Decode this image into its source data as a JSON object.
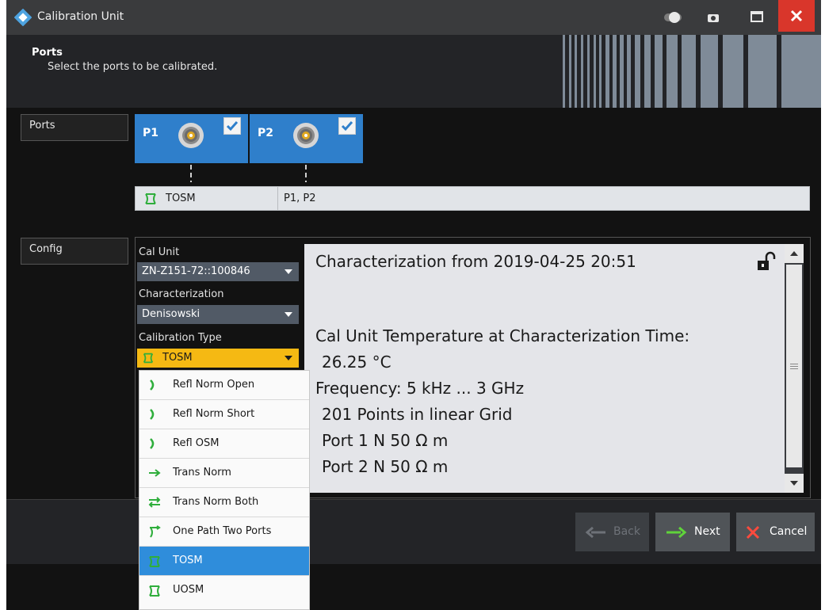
{
  "window": {
    "title": "Calibration Unit"
  },
  "header": {
    "title": "Ports",
    "subtitle": "Select the ports to be calibrated."
  },
  "sections": {
    "ports_label": "Ports",
    "config_label": "Config"
  },
  "ports": [
    {
      "name": "P1",
      "checked": true
    },
    {
      "name": "P2",
      "checked": true
    }
  ],
  "selection": {
    "type": "TOSM",
    "ports": "P1, P2"
  },
  "config": {
    "cal_unit_label": "Cal Unit",
    "cal_unit_value": "ZN-Z151-72::100846",
    "characterization_label": "Characterization",
    "characterization_value": "Denisowski",
    "calibration_type_label": "Calibration Type",
    "calibration_type_value": "TOSM"
  },
  "info": {
    "title": "Characterization from 2019-04-25 20:51",
    "lines": [
      "Cal Unit Temperature at Characterization Time:",
      "26.25 °C",
      "Frequency: 5 kHz ... 3 GHz",
      "201 Points in linear Grid",
      "Port 1 N 50 Ω m",
      "Port 2 N 50 Ω m"
    ]
  },
  "dropdown": {
    "items": [
      {
        "label": "Refl Norm Open",
        "icon": "refl-icon"
      },
      {
        "label": "Refl Norm Short",
        "icon": "refl-icon"
      },
      {
        "label": "Refl OSM",
        "icon": "refl-icon"
      },
      {
        "label": "Trans Norm",
        "icon": "arrow-right-icon"
      },
      {
        "label": "Trans Norm Both",
        "icon": "arrows-both-icon"
      },
      {
        "label": "One Path Two Ports",
        "icon": "one-path-icon"
      },
      {
        "label": "TOSM",
        "icon": "two-port-icon",
        "selected": true
      },
      {
        "label": "UOSM",
        "icon": "two-port-icon"
      }
    ]
  },
  "footer": {
    "back": "Back",
    "next": "Next",
    "cancel": "Cancel"
  },
  "colors": {
    "accent_blue": "#2f7fcb",
    "combo_active": "#f5b913",
    "close_red": "#d9362b",
    "icon_green": "#2fae3c"
  }
}
